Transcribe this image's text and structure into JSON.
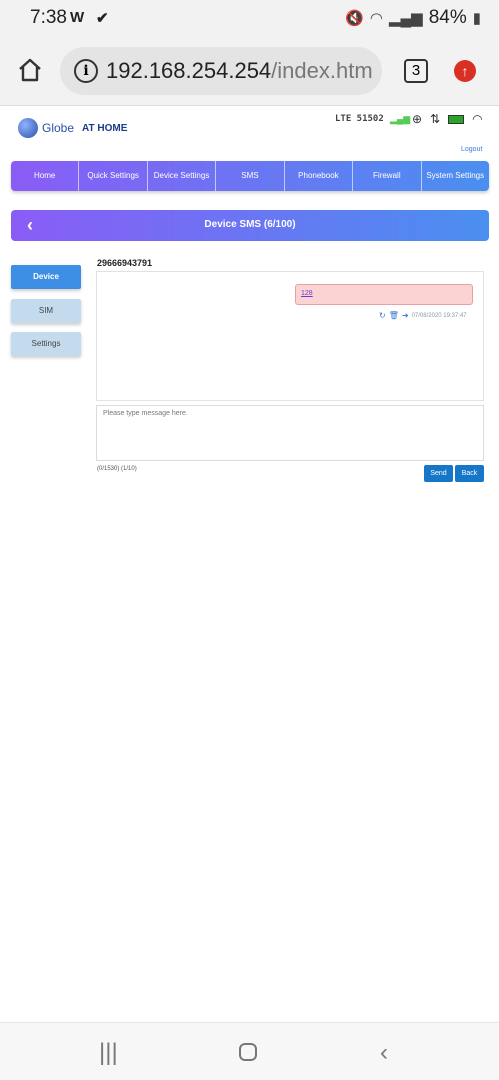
{
  "statusbar": {
    "time": "7:38",
    "notif_w": "W",
    "notif_check": "✔",
    "battery": "84%"
  },
  "browser": {
    "url_host": "192.168.254.254",
    "url_path": "/index.html",
    "tab_count": "3"
  },
  "router": {
    "brand": "Globe",
    "brand_tag": "AT HOME",
    "network": "LTE 51502",
    "logout": "Logout"
  },
  "nav": {
    "items": [
      "Home",
      "Quick Settings",
      "Device Settings",
      "SMS",
      "Phonebook",
      "Firewall",
      "System Settings"
    ]
  },
  "page": {
    "title": "Device SMS (6/100)"
  },
  "side": {
    "items": [
      "Device",
      "SIM",
      "Settings"
    ]
  },
  "conversation": {
    "phone": "29666943791",
    "message_text": "128",
    "message_time": "07/08/2020 19:37:47"
  },
  "compose": {
    "placeholder": "Please type message here.",
    "counter": "(0/1530) (1/10)",
    "send_label": "Send",
    "back_label": "Back"
  },
  "colors": {
    "nav_gradient_start": "#8a5cf6",
    "nav_gradient_end": "#4a8ff0",
    "active_side": "#3d8fe6",
    "button_blue": "#1677c8",
    "bubble_pink": "#fbd3d3"
  }
}
